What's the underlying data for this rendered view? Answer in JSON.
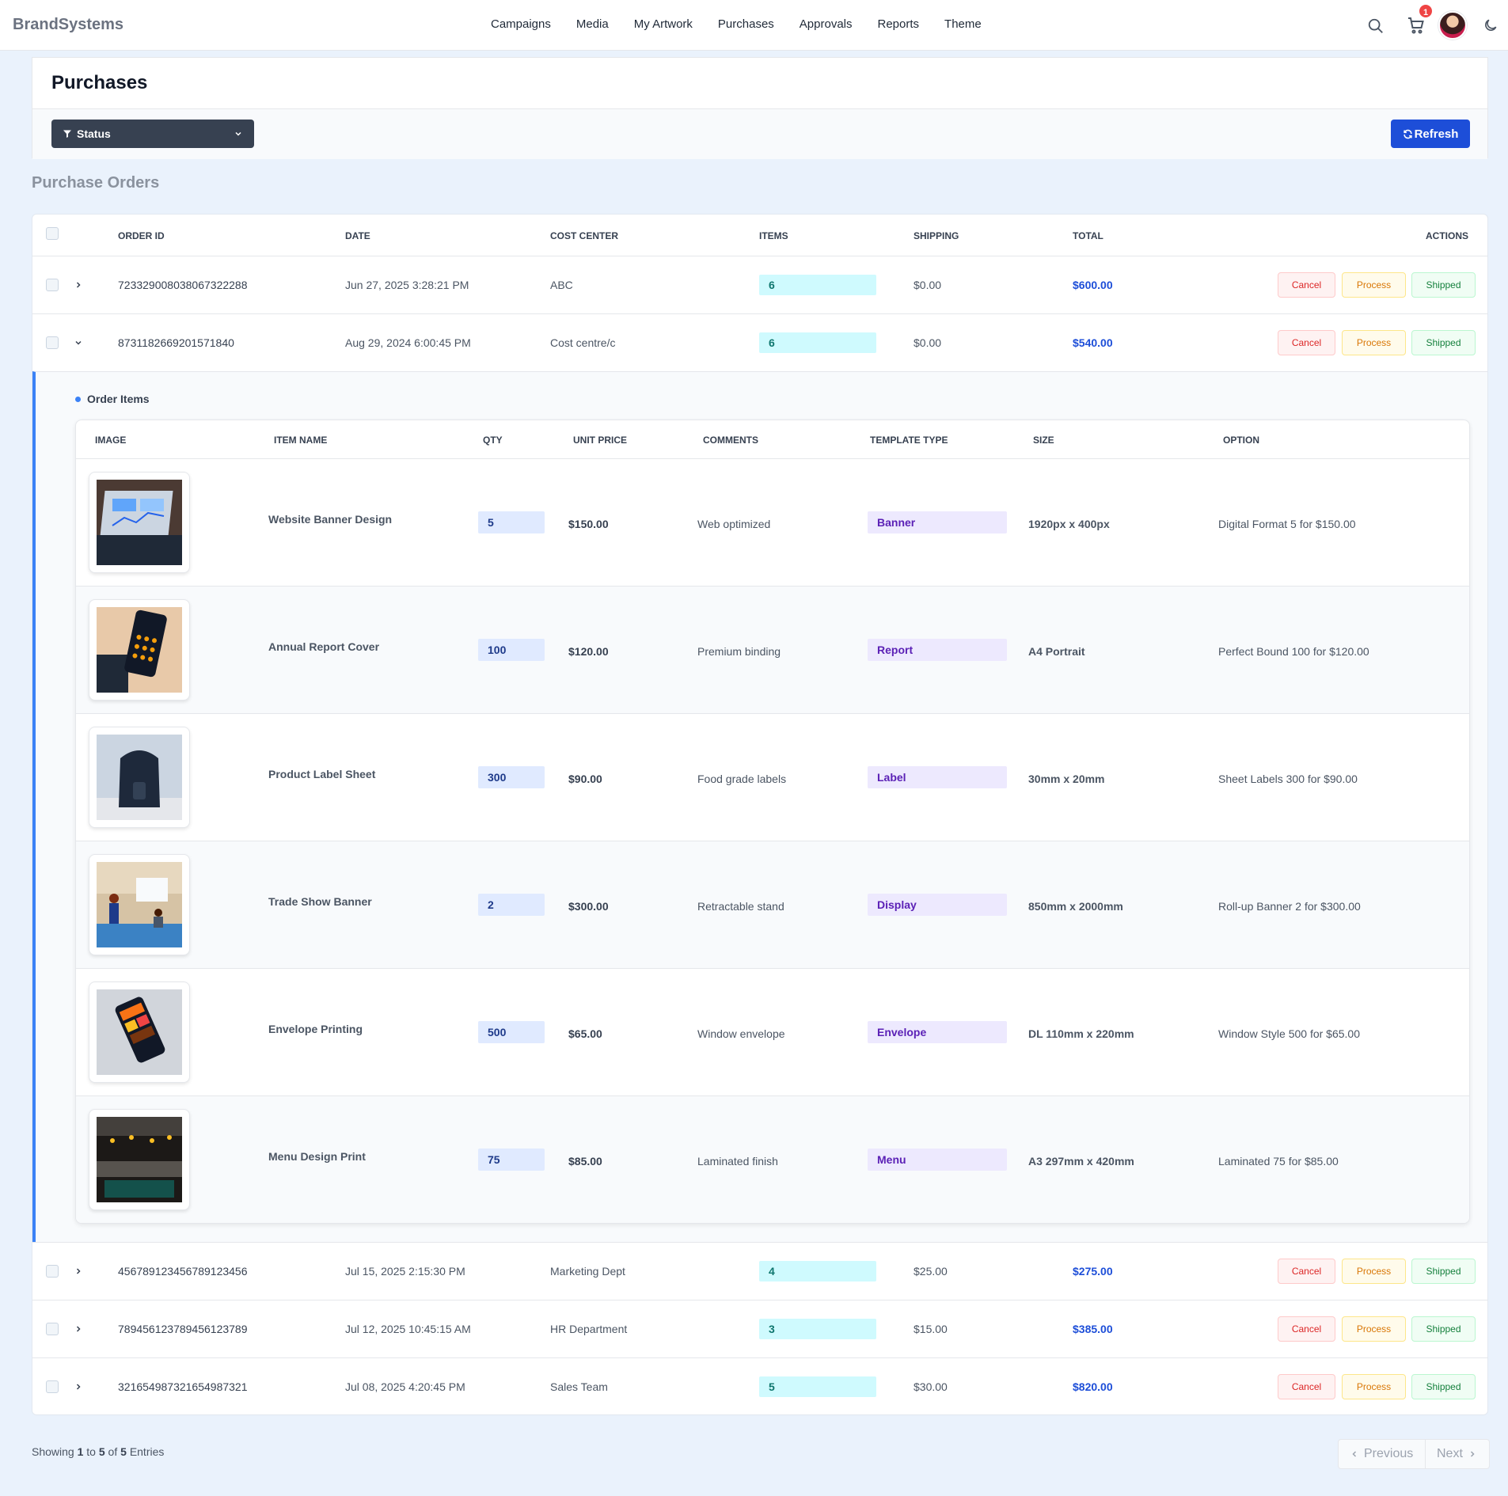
{
  "nav": {
    "brand": "BrandSystems",
    "links": [
      "Campaigns",
      "Media",
      "My Artwork",
      "Purchases",
      "Approvals",
      "Reports",
      "Theme"
    ],
    "cart_count": "1"
  },
  "page": {
    "title": "Purchases",
    "status_filter": "Status",
    "refresh_label": "Refresh",
    "section_title": "Purchase Orders"
  },
  "table": {
    "headers": {
      "order_id": "ORDER ID",
      "date": "DATE",
      "cost_center": "COST CENTER",
      "items": "ITEMS",
      "shipping": "SHIPPING",
      "total": "TOTAL",
      "actions": "ACTIONS"
    },
    "actions": {
      "cancel": "Cancel",
      "process": "Process",
      "shipped": "Shipped"
    },
    "orders": [
      {
        "id": "723329008038067322288",
        "date": "Jun 27, 2025 3:28:21 PM",
        "cost_center": "ABC",
        "items": "6",
        "shipping": "$0.00",
        "total": "$600.00",
        "expanded": false
      },
      {
        "id": "8731182669201571840",
        "date": "Aug 29, 2024 6:00:45 PM",
        "cost_center": "Cost centre/c",
        "items": "6",
        "shipping": "$0.00",
        "total": "$540.00",
        "expanded": true
      },
      {
        "id": "456789123456789123456",
        "date": "Jul 15, 2025 2:15:30 PM",
        "cost_center": "Marketing Dept",
        "items": "4",
        "shipping": "$25.00",
        "total": "$275.00",
        "expanded": false
      },
      {
        "id": "789456123789456123789",
        "date": "Jul 12, 2025 10:45:15 AM",
        "cost_center": "HR Department",
        "items": "3",
        "shipping": "$15.00",
        "total": "$385.00",
        "expanded": false
      },
      {
        "id": "321654987321654987321",
        "date": "Jul 08, 2025 4:20:45 PM",
        "cost_center": "Sales Team",
        "items": "5",
        "shipping": "$30.00",
        "total": "$820.00",
        "expanded": false
      }
    ]
  },
  "order_items": {
    "label": "Order Items",
    "headers": {
      "image": "IMAGE",
      "item_name": "ITEM NAME",
      "qty": "QTY",
      "unit_price": "UNIT PRICE",
      "comments": "COMMENTS",
      "template_type": "TEMPLATE TYPE",
      "size": "SIZE",
      "option": "OPTION"
    },
    "rows": [
      {
        "name": "Website Banner Design",
        "qty": "5",
        "unit_price": "$150.00",
        "comments": "Web optimized",
        "template_type": "Banner",
        "size": "1920px x 400px",
        "option": "Digital Format 5 for $150.00",
        "image": "laptop-dashboard-photo"
      },
      {
        "name": "Annual Report Cover",
        "qty": "100",
        "unit_price": "$120.00",
        "comments": "Premium binding",
        "template_type": "Report",
        "size": "A4 Portrait",
        "option": "Perfect Bound 100 for $120.00",
        "image": "calculator-photo"
      },
      {
        "name": "Product Label Sheet",
        "qty": "300",
        "unit_price": "$90.00",
        "comments": "Food grade labels",
        "template_type": "Label",
        "size": "30mm x 20mm",
        "option": "Sheet Labels 300 for $90.00",
        "image": "backpack-photo"
      },
      {
        "name": "Trade Show Banner",
        "qty": "2",
        "unit_price": "$300.00",
        "comments": "Retractable stand",
        "template_type": "Display",
        "size": "850mm x 2000mm",
        "option": "Roll-up Banner 2 for $300.00",
        "image": "meeting-room-photo"
      },
      {
        "name": "Envelope Printing",
        "qty": "500",
        "unit_price": "$65.00",
        "comments": "Window envelope",
        "template_type": "Envelope",
        "size": "DL 110mm x 220mm",
        "option": "Window Style 500 for $65.00",
        "image": "smartphone-photo"
      },
      {
        "name": "Menu Design Print",
        "qty": "75",
        "unit_price": "$85.00",
        "comments": "Laminated finish",
        "template_type": "Menu",
        "size": "A3 297mm x 420mm",
        "option": "Laminated 75 for $85.00",
        "image": "restaurant-interior-photo"
      }
    ]
  },
  "pagination": {
    "showing_prefix": "Showing",
    "from": "1",
    "to_word": "to",
    "to": "5",
    "of_word": "of",
    "total": "5",
    "suffix": "Entries",
    "previous": "Previous",
    "next": "Next"
  },
  "colors": {
    "primary": "#1d4ed8",
    "accent_bar": "#3b82f6",
    "items_pill": "#cffafe",
    "qty_pill": "#e0eaff",
    "type_pill": "#ede9fe"
  }
}
